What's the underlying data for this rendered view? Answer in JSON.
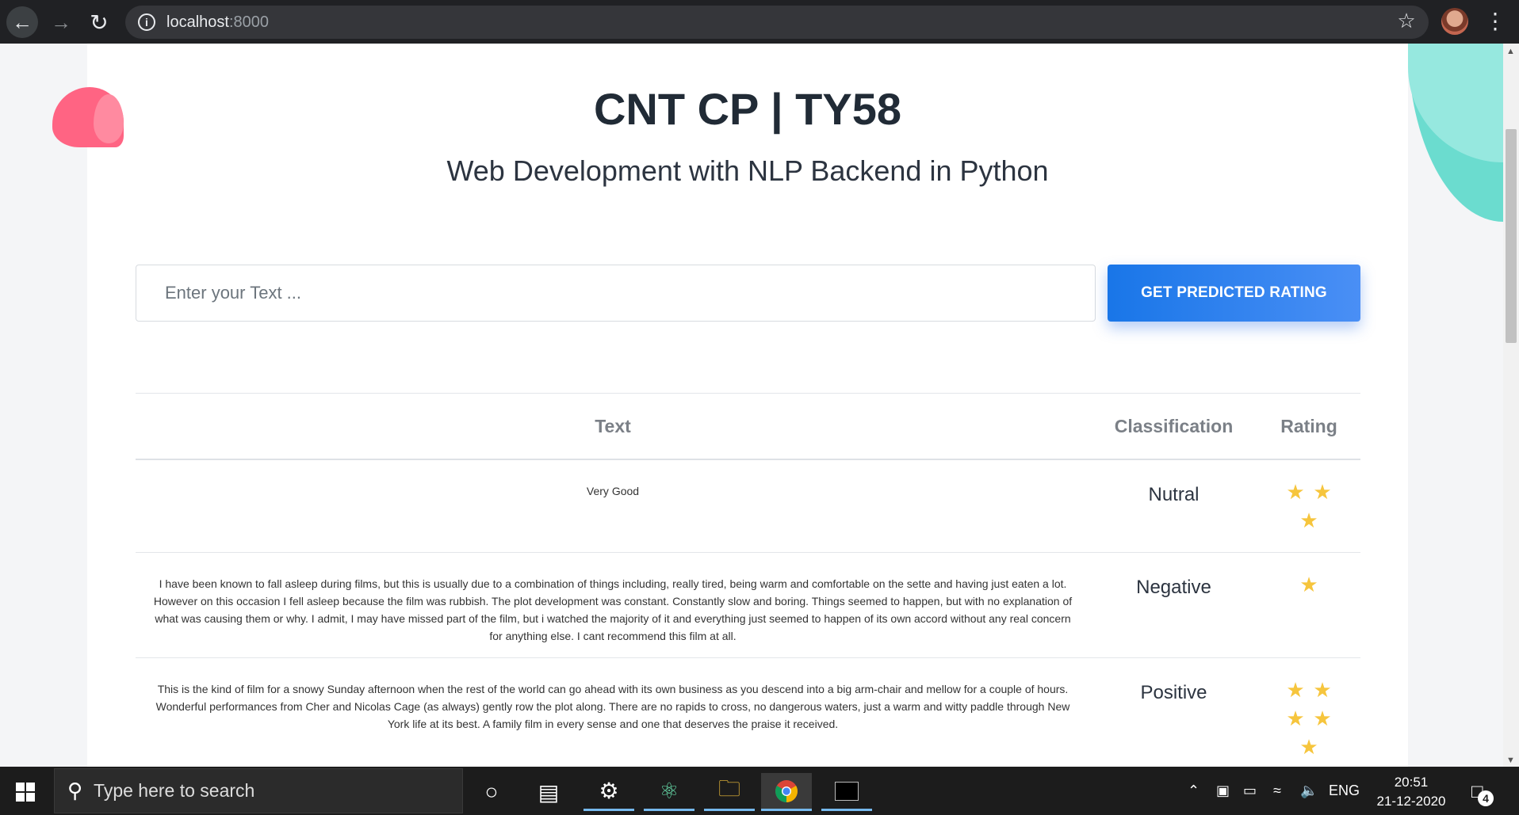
{
  "browser": {
    "url_host": "localhost",
    "url_port": ":8000"
  },
  "page": {
    "title": "CNT CP | TY58",
    "subtitle": "Web Development with NLP Backend in Python",
    "input_placeholder": "Enter your Text ...",
    "predict_button": "GET PREDICTED RATING"
  },
  "table": {
    "headers": {
      "text": "Text",
      "classification": "Classification",
      "rating": "Rating"
    },
    "rows": [
      {
        "text": "Very Good",
        "classification": "Nutral",
        "rating": 3
      },
      {
        "text": "I have been known to fall asleep during films, but this is usually due to a combination of things including, really tired, being warm and comfortable on the sette and having just eaten a lot. However on this occasion I fell asleep because the film was rubbish. The plot development was constant. Constantly slow and boring. Things seemed to happen, but with no explanation of what was causing them or why. I admit, I may have missed part of the film, but i watched the majority of it and everything just seemed to happen of its own accord without any real concern for anything else. I cant recommend this film at all.",
        "classification": "Negative",
        "rating": 1
      },
      {
        "text": "This is the kind of film for a snowy Sunday afternoon when the rest of the world can go ahead with its own business as you descend into a big arm-chair and mellow for a couple of hours. Wonderful performances from Cher and Nicolas Cage (as always) gently row the plot along. There are no rapids to cross, no dangerous waters, just a warm and witty paddle through New York life at its best. A family film in every sense and one that deserves the praise it received.",
        "classification": "Positive",
        "rating": 5
      }
    ]
  },
  "taskbar": {
    "search_placeholder": "Type here to search",
    "language": "ENG",
    "time": "20:51",
    "date": "21-12-2020",
    "notification_count": "4"
  },
  "colors": {
    "primary_button": "#1976e8",
    "star": "#f6c53d",
    "pink_blob": "#ff6483",
    "teal_blob": "#6bdccf"
  }
}
